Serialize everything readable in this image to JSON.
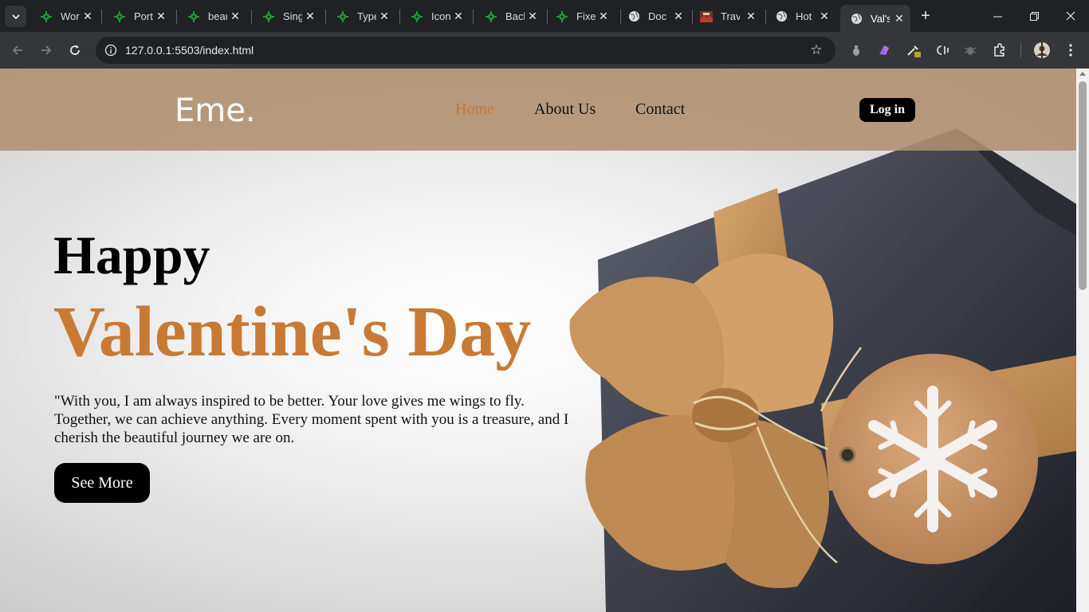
{
  "browser": {
    "tabs": [
      {
        "title": "Wor",
        "icon": "green-gear-icon"
      },
      {
        "title": "Port",
        "icon": "green-gear-icon"
      },
      {
        "title": "beau",
        "icon": "green-gear-icon"
      },
      {
        "title": "Sing",
        "icon": "green-gear-icon"
      },
      {
        "title": "Type",
        "icon": "green-gear-icon"
      },
      {
        "title": "Icon",
        "icon": "green-gear-icon"
      },
      {
        "title": "Back",
        "icon": "green-gear-icon"
      },
      {
        "title": "Fixe",
        "icon": "green-gear-icon"
      },
      {
        "title": "Doc",
        "icon": "globe-icon"
      },
      {
        "title": "Trav",
        "icon": "image-thumbnail-icon"
      },
      {
        "title": "Hot",
        "icon": "globe-icon"
      },
      {
        "title": "Val's",
        "icon": "globe-icon",
        "active": true
      }
    ],
    "new_tab_label": "+",
    "url": "127.0.0.1:5503/index.html"
  },
  "site": {
    "logo": "Eme.",
    "nav": [
      {
        "label": "Home",
        "active": true
      },
      {
        "label": "About Us"
      },
      {
        "label": "Contact"
      }
    ],
    "login_label": "Log in",
    "hero": {
      "line1": "Happy",
      "line2": "Valentine's Day",
      "quote": "\"With you, I am always inspired to be better. Your love gives me wings to fly. Together, we can achieve anything. Every moment spent with you is a treasure, and I cherish the beautiful journey we are on.",
      "cta": "See More"
    }
  },
  "colors": {
    "accent": "#c87a35",
    "header_bg": "#b09070",
    "button_bg": "#000000"
  }
}
